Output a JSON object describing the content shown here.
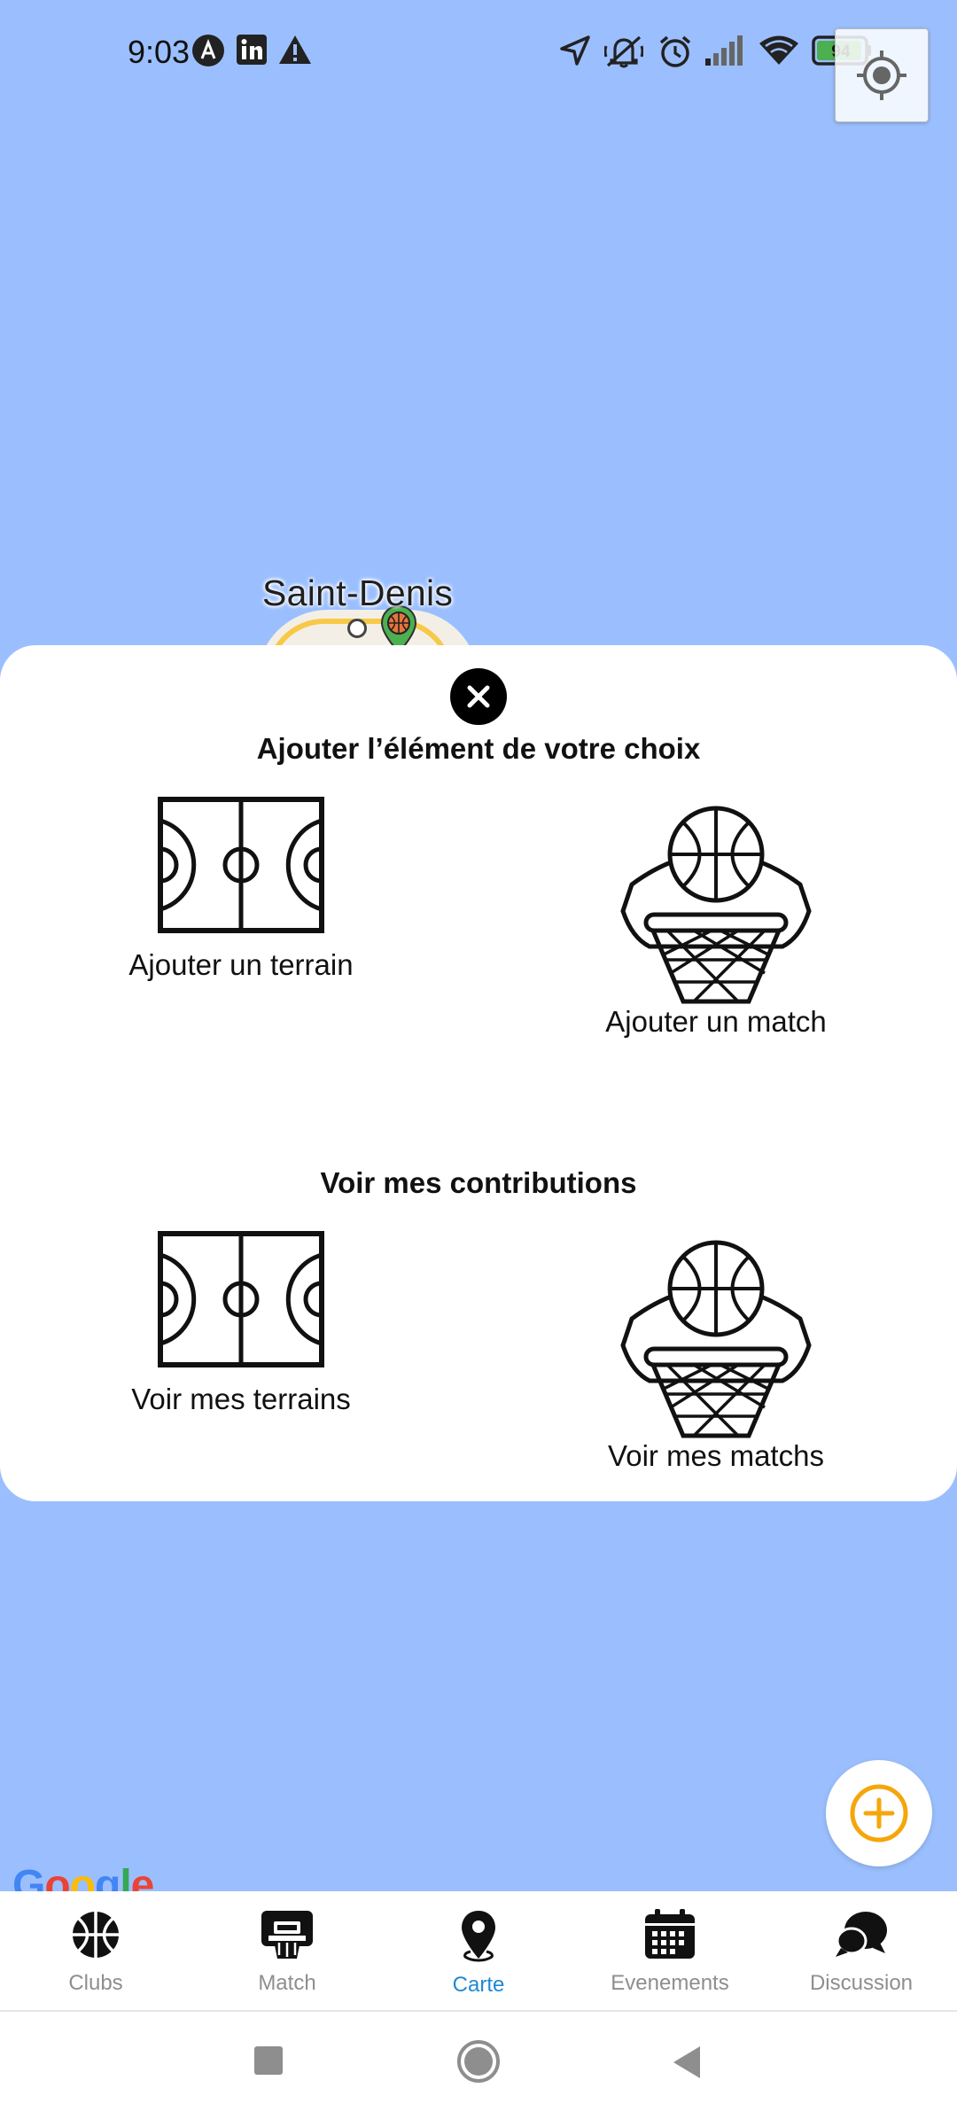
{
  "status_bar": {
    "time": "9:03",
    "battery_level": "94"
  },
  "map": {
    "city_label": "Saint-Denis",
    "google_logo": [
      "G",
      "o",
      "o",
      "g",
      "l",
      "e"
    ]
  },
  "sheet": {
    "add_title": "Ajouter l’élément de votre choix",
    "add_options": [
      {
        "label": "Ajouter un terrain",
        "icon": "basketball-court-icon"
      },
      {
        "label": "Ajouter un match",
        "icon": "basketball-hoop-icon"
      }
    ],
    "contrib_title": "Voir mes contributions",
    "contrib_options": [
      {
        "label": "Voir mes terrains",
        "icon": "basketball-court-icon"
      },
      {
        "label": "Voir mes matchs",
        "icon": "basketball-hoop-icon"
      }
    ]
  },
  "bottom_nav": {
    "items": [
      {
        "label": "Clubs",
        "icon": "basketball-icon"
      },
      {
        "label": "Match",
        "icon": "hoop-icon"
      },
      {
        "label": "Carte",
        "icon": "map-pin-icon"
      },
      {
        "label": "Evenements",
        "icon": "calendar-icon"
      },
      {
        "label": "Discussion",
        "icon": "chat-icon"
      }
    ],
    "active_index": 2
  },
  "colors": {
    "map_water": "#9bbffe",
    "active_tab": "#1e88d6",
    "fab_accent": "#f5a60a",
    "battery_green": "#4caf50"
  }
}
